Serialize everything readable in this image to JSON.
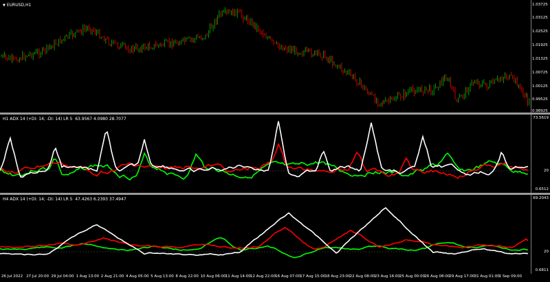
{
  "main_pane": {
    "title": "EURUSD,H1",
    "price_ticks": [
      "1.03725",
      "1.03125",
      "1.02525",
      "1.01925",
      "1.01325",
      "1.00725",
      "1.00125",
      "0.99525",
      "0.98925"
    ]
  },
  "adx_h1": {
    "title": "H1 ADX 14 (+DI: 14; -DI: 14) LR 5",
    "values_text": "63.9567 4.0980 28.7077",
    "scale_top": "73.5619",
    "scale_level": "20",
    "scale_bottom": "0.6512"
  },
  "adx_h4": {
    "title": "H4 ADX 14 (+DI: 14; -DI: 14) LR 5",
    "values_text": "47.4263 6.2393 37.4947",
    "scale_top": "69.2043",
    "scale_level": "20",
    "scale_bottom": "0.6811"
  },
  "time_axis": [
    "26 Jul 2022",
    "27 Jul 20:00",
    "29 Jul 04:00",
    "1 Aug 13:00",
    "2 Aug 21:00",
    "4 Aug 05:00",
    "5 Aug 13:00",
    "8 Aug 22:00",
    "10 Aug 06:00",
    "11 Aug 14:00",
    "12 Aug 22:00",
    "16 Aug 07:00",
    "17 Aug 15:00",
    "18 Aug 23:00",
    "22 Aug 08:00",
    "23 Aug 16:00",
    "25 Aug 00:00",
    "26 Aug 08:00",
    "29 Aug 17:00",
    "31 Aug 01:00",
    "1 Sep 09:00"
  ],
  "colors": {
    "bull": "#00c000",
    "bear": "#ff0000",
    "adx": "#ffffff",
    "plus_di": "#00ff00",
    "minus_di": "#ff0000",
    "separator": "#9a9a9a"
  },
  "icons": {
    "dropdown": "triangle-down-icon"
  }
}
